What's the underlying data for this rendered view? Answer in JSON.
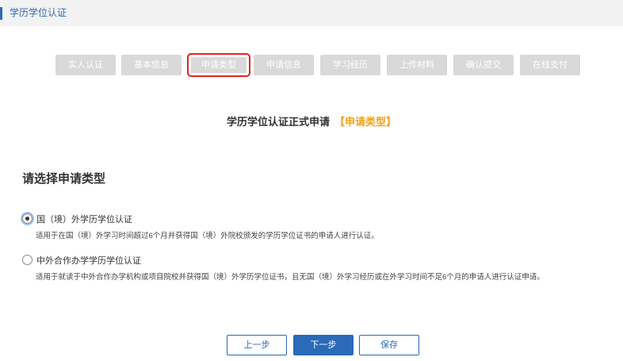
{
  "header": {
    "title": "学历学位认证"
  },
  "steps": [
    {
      "label": "实人认证"
    },
    {
      "label": "基本信息"
    },
    {
      "label": "申请类型"
    },
    {
      "label": "申请信息"
    },
    {
      "label": "学习经历"
    },
    {
      "label": "上传材料"
    },
    {
      "label": "确认提交"
    },
    {
      "label": "在线支付"
    }
  ],
  "active_step": "申请类型",
  "form": {
    "title": "学历学位认证正式申请",
    "title_tag": "【申请类型】",
    "section_title": "请选择申请类型"
  },
  "options": [
    {
      "label": "国（境）外学历学位认证",
      "description": "适用于在国（境）外学习时间超过6个月并获得国（境）外院校颁发的学历学位证书的申请人进行认证。",
      "selected": true
    },
    {
      "label": "中外合作办学学历学位认证",
      "description": "适用于就读于中外合作办学机构或项目院校并获得国（境）外学历学位证书，且无国（境）外学习经历或在外学习时间不足6个月的申请人进行认证申请。",
      "selected": false
    }
  ],
  "buttons": {
    "prev": "上一步",
    "next": "下一步",
    "save": "保存"
  },
  "colors": {
    "accent": "#2a6ab8",
    "highlight": "#f2a21c",
    "active_outline": "#e8221e",
    "step_bg": "#d9d9d9"
  }
}
